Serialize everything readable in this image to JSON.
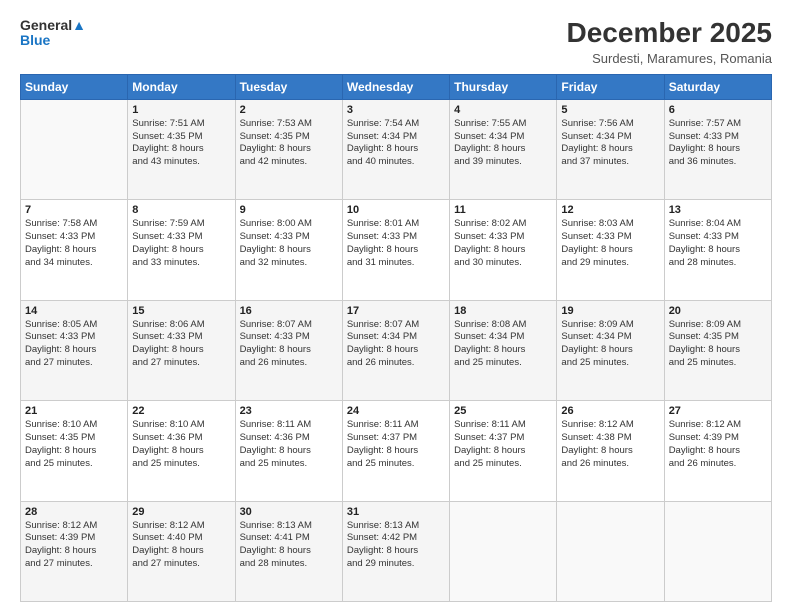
{
  "header": {
    "title": "December 2025",
    "subtitle": "Surdesti, Maramures, Romania"
  },
  "days": [
    "Sunday",
    "Monday",
    "Tuesday",
    "Wednesday",
    "Thursday",
    "Friday",
    "Saturday"
  ],
  "weeks": [
    [
      {
        "num": "",
        "sunrise": "",
        "sunset": "",
        "daylight": ""
      },
      {
        "num": "1",
        "sunrise": "Sunrise: 7:51 AM",
        "sunset": "Sunset: 4:35 PM",
        "daylight": "Daylight: 8 hours and 43 minutes."
      },
      {
        "num": "2",
        "sunrise": "Sunrise: 7:53 AM",
        "sunset": "Sunset: 4:35 PM",
        "daylight": "Daylight: 8 hours and 42 minutes."
      },
      {
        "num": "3",
        "sunrise": "Sunrise: 7:54 AM",
        "sunset": "Sunset: 4:34 PM",
        "daylight": "Daylight: 8 hours and 40 minutes."
      },
      {
        "num": "4",
        "sunrise": "Sunrise: 7:55 AM",
        "sunset": "Sunset: 4:34 PM",
        "daylight": "Daylight: 8 hours and 39 minutes."
      },
      {
        "num": "5",
        "sunrise": "Sunrise: 7:56 AM",
        "sunset": "Sunset: 4:34 PM",
        "daylight": "Daylight: 8 hours and 37 minutes."
      },
      {
        "num": "6",
        "sunrise": "Sunrise: 7:57 AM",
        "sunset": "Sunset: 4:33 PM",
        "daylight": "Daylight: 8 hours and 36 minutes."
      }
    ],
    [
      {
        "num": "7",
        "sunrise": "Sunrise: 7:58 AM",
        "sunset": "Sunset: 4:33 PM",
        "daylight": "Daylight: 8 hours and 34 minutes."
      },
      {
        "num": "8",
        "sunrise": "Sunrise: 7:59 AM",
        "sunset": "Sunset: 4:33 PM",
        "daylight": "Daylight: 8 hours and 33 minutes."
      },
      {
        "num": "9",
        "sunrise": "Sunrise: 8:00 AM",
        "sunset": "Sunset: 4:33 PM",
        "daylight": "Daylight: 8 hours and 32 minutes."
      },
      {
        "num": "10",
        "sunrise": "Sunrise: 8:01 AM",
        "sunset": "Sunset: 4:33 PM",
        "daylight": "Daylight: 8 hours and 31 minutes."
      },
      {
        "num": "11",
        "sunrise": "Sunrise: 8:02 AM",
        "sunset": "Sunset: 4:33 PM",
        "daylight": "Daylight: 8 hours and 30 minutes."
      },
      {
        "num": "12",
        "sunrise": "Sunrise: 8:03 AM",
        "sunset": "Sunset: 4:33 PM",
        "daylight": "Daylight: 8 hours and 29 minutes."
      },
      {
        "num": "13",
        "sunrise": "Sunrise: 8:04 AM",
        "sunset": "Sunset: 4:33 PM",
        "daylight": "Daylight: 8 hours and 28 minutes."
      }
    ],
    [
      {
        "num": "14",
        "sunrise": "Sunrise: 8:05 AM",
        "sunset": "Sunset: 4:33 PM",
        "daylight": "Daylight: 8 hours and 27 minutes."
      },
      {
        "num": "15",
        "sunrise": "Sunrise: 8:06 AM",
        "sunset": "Sunset: 4:33 PM",
        "daylight": "Daylight: 8 hours and 27 minutes."
      },
      {
        "num": "16",
        "sunrise": "Sunrise: 8:07 AM",
        "sunset": "Sunset: 4:33 PM",
        "daylight": "Daylight: 8 hours and 26 minutes."
      },
      {
        "num": "17",
        "sunrise": "Sunrise: 8:07 AM",
        "sunset": "Sunset: 4:34 PM",
        "daylight": "Daylight: 8 hours and 26 minutes."
      },
      {
        "num": "18",
        "sunrise": "Sunrise: 8:08 AM",
        "sunset": "Sunset: 4:34 PM",
        "daylight": "Daylight: 8 hours and 25 minutes."
      },
      {
        "num": "19",
        "sunrise": "Sunrise: 8:09 AM",
        "sunset": "Sunset: 4:34 PM",
        "daylight": "Daylight: 8 hours and 25 minutes."
      },
      {
        "num": "20",
        "sunrise": "Sunrise: 8:09 AM",
        "sunset": "Sunset: 4:35 PM",
        "daylight": "Daylight: 8 hours and 25 minutes."
      }
    ],
    [
      {
        "num": "21",
        "sunrise": "Sunrise: 8:10 AM",
        "sunset": "Sunset: 4:35 PM",
        "daylight": "Daylight: 8 hours and 25 minutes."
      },
      {
        "num": "22",
        "sunrise": "Sunrise: 8:10 AM",
        "sunset": "Sunset: 4:36 PM",
        "daylight": "Daylight: 8 hours and 25 minutes."
      },
      {
        "num": "23",
        "sunrise": "Sunrise: 8:11 AM",
        "sunset": "Sunset: 4:36 PM",
        "daylight": "Daylight: 8 hours and 25 minutes."
      },
      {
        "num": "24",
        "sunrise": "Sunrise: 8:11 AM",
        "sunset": "Sunset: 4:37 PM",
        "daylight": "Daylight: 8 hours and 25 minutes."
      },
      {
        "num": "25",
        "sunrise": "Sunrise: 8:11 AM",
        "sunset": "Sunset: 4:37 PM",
        "daylight": "Daylight: 8 hours and 25 minutes."
      },
      {
        "num": "26",
        "sunrise": "Sunrise: 8:12 AM",
        "sunset": "Sunset: 4:38 PM",
        "daylight": "Daylight: 8 hours and 26 minutes."
      },
      {
        "num": "27",
        "sunrise": "Sunrise: 8:12 AM",
        "sunset": "Sunset: 4:39 PM",
        "daylight": "Daylight: 8 hours and 26 minutes."
      }
    ],
    [
      {
        "num": "28",
        "sunrise": "Sunrise: 8:12 AM",
        "sunset": "Sunset: 4:39 PM",
        "daylight": "Daylight: 8 hours and 27 minutes."
      },
      {
        "num": "29",
        "sunrise": "Sunrise: 8:12 AM",
        "sunset": "Sunset: 4:40 PM",
        "daylight": "Daylight: 8 hours and 27 minutes."
      },
      {
        "num": "30",
        "sunrise": "Sunrise: 8:13 AM",
        "sunset": "Sunset: 4:41 PM",
        "daylight": "Daylight: 8 hours and 28 minutes."
      },
      {
        "num": "31",
        "sunrise": "Sunrise: 8:13 AM",
        "sunset": "Sunset: 4:42 PM",
        "daylight": "Daylight: 8 hours and 29 minutes."
      },
      {
        "num": "",
        "sunrise": "",
        "sunset": "",
        "daylight": ""
      },
      {
        "num": "",
        "sunrise": "",
        "sunset": "",
        "daylight": ""
      },
      {
        "num": "",
        "sunrise": "",
        "sunset": "",
        "daylight": ""
      }
    ]
  ]
}
